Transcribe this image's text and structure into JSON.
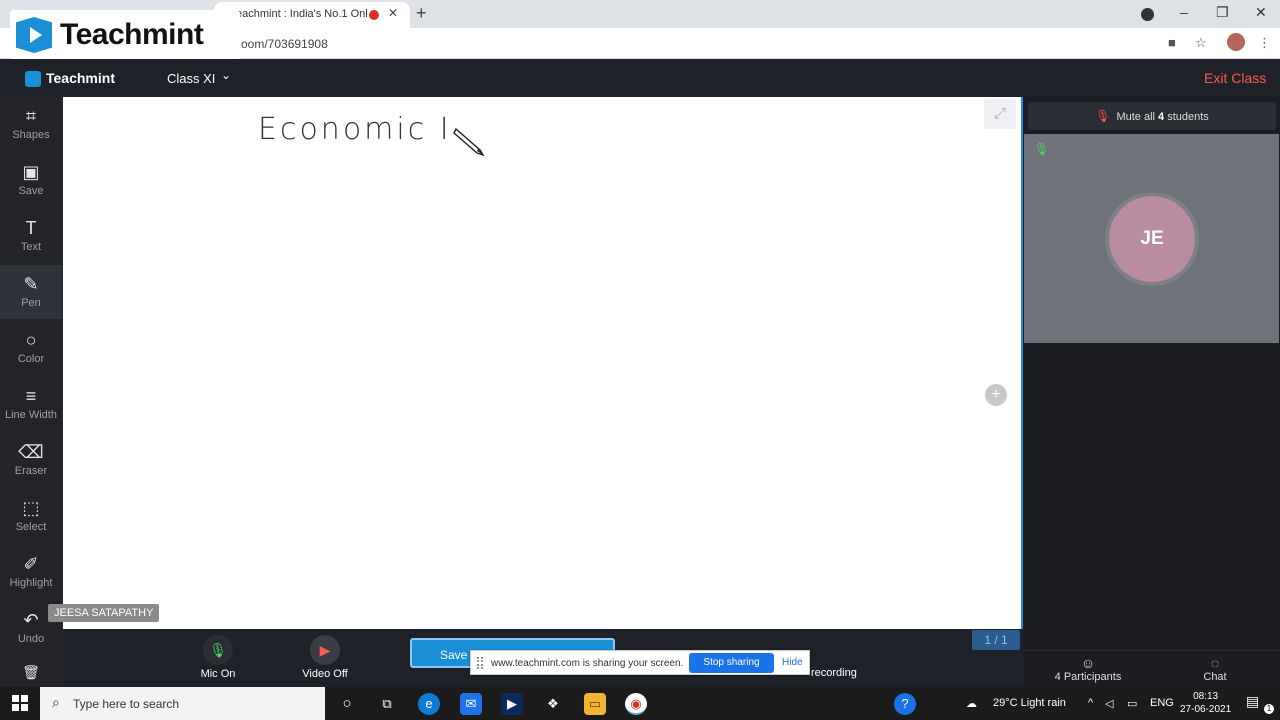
{
  "browser": {
    "tab_title": "eachmint : India's No.1 Onl",
    "url": "oom/703691908",
    "newtab_label": "+",
    "tab_close": "✕",
    "win_min": "–",
    "win_max": "❐",
    "win_close": "✕"
  },
  "watermark": {
    "brand": "Teachmint"
  },
  "header": {
    "brand": "Teachmint",
    "class_name": "Class XI",
    "exit_label": "Exit Class"
  },
  "tools": [
    {
      "label": "Shapes",
      "icon": "⌗"
    },
    {
      "label": "Save",
      "icon": "▣"
    },
    {
      "label": "Text",
      "icon": "T"
    },
    {
      "label": "Pen",
      "icon": "✎"
    },
    {
      "label": "Color",
      "icon": "○"
    },
    {
      "label": "Line Width",
      "icon": "≡"
    },
    {
      "label": "Eraser",
      "icon": "⌫"
    },
    {
      "label": "Select",
      "icon": "⬚"
    },
    {
      "label": "Highlight",
      "icon": "✐"
    },
    {
      "label": "Undo",
      "icon": "↶"
    },
    {
      "label": "",
      "icon": "🗑"
    }
  ],
  "presenter_name": "JEESA SATAPATHY",
  "board": {
    "handwriting": "Economic I",
    "page_indicator": "1 / 1",
    "expand_icon": "⤢",
    "add_icon": "+"
  },
  "controls": {
    "mic_label": "Mic On",
    "video_label": "Video Off",
    "save_label": "Save",
    "recording_label": "recording"
  },
  "share_banner": {
    "text": "www.teachmint.com is sharing your screen.",
    "stop_label": "Stop sharing",
    "hide_label": "Hide"
  },
  "right_panel": {
    "mute_prefix": "Mute all ",
    "mute_count": "4",
    "mute_suffix": " students",
    "avatar_initials": "JE",
    "participants_label": "4 Participants",
    "chat_label": "Chat"
  },
  "taskbar": {
    "search_placeholder": "Type here to search",
    "weather": "29°C  Light rain",
    "lang": "ENG",
    "time": "08:13",
    "date": "27-06-2021",
    "notif_count": "1"
  },
  "colors": {
    "accent": "#1a8fd6",
    "exit": "#ff5a4f",
    "dark_bg": "#1f2128"
  }
}
